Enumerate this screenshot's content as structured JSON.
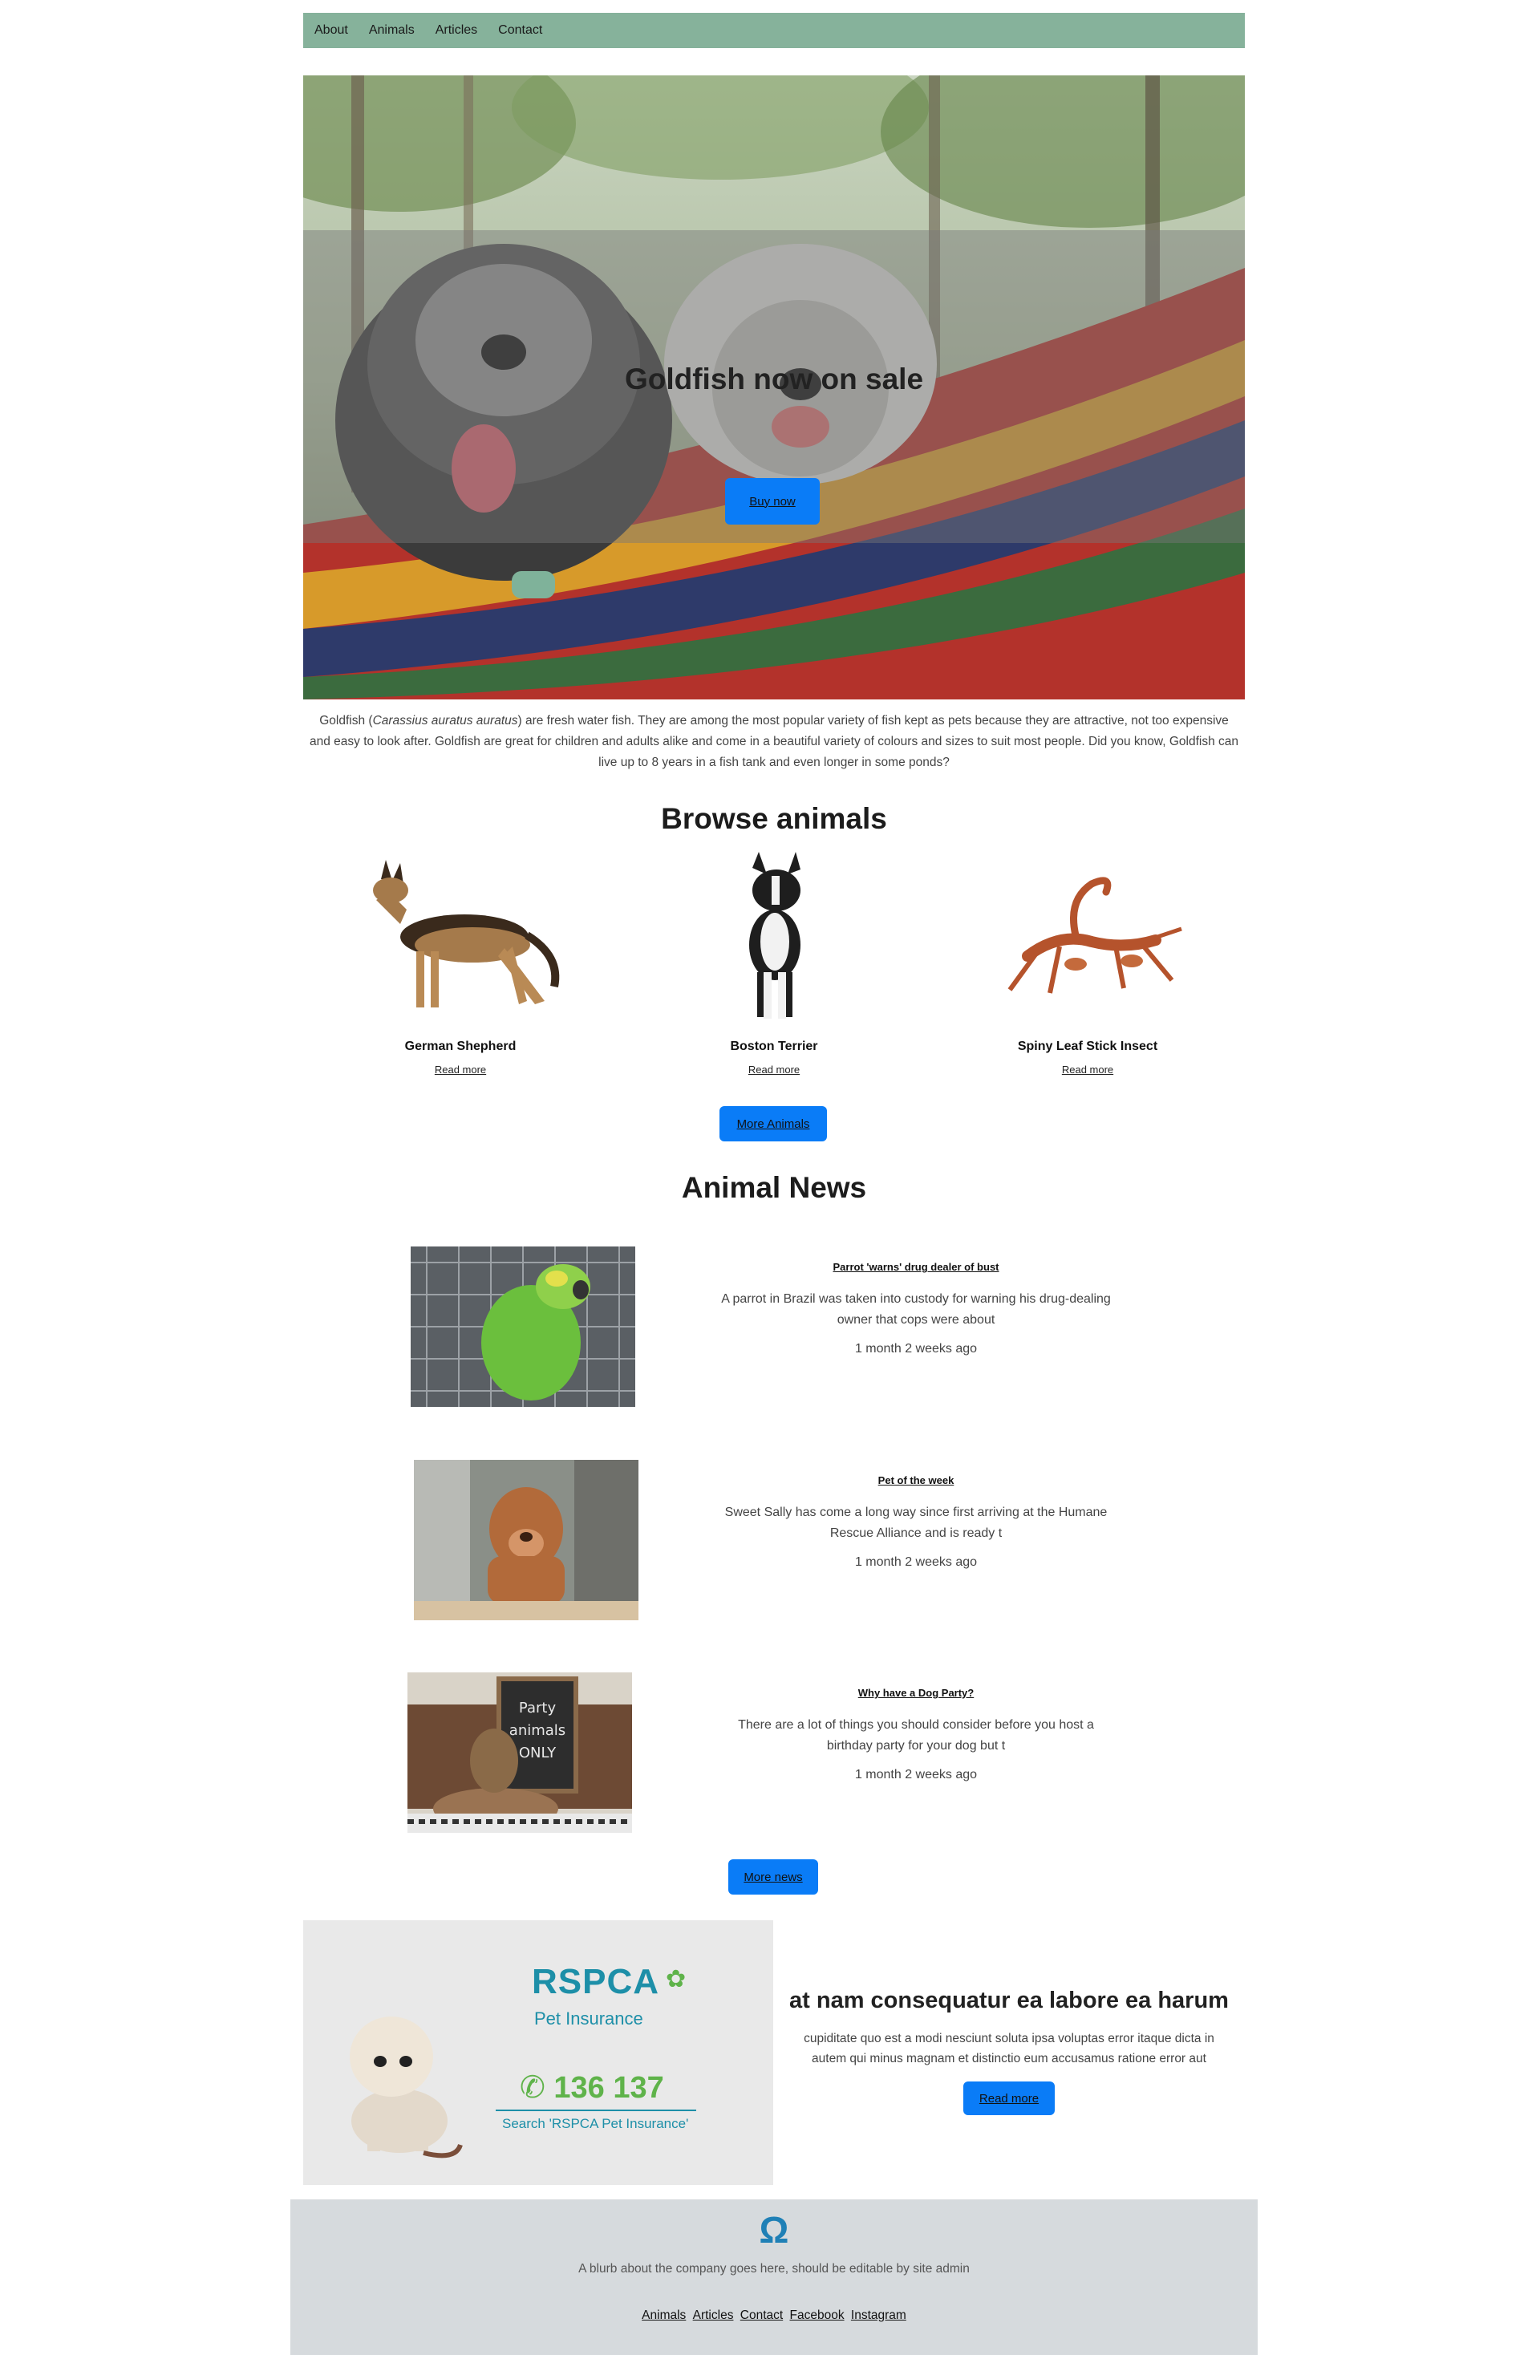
{
  "nav": {
    "items": [
      "About",
      "Animals",
      "Articles",
      "Contact"
    ]
  },
  "hero": {
    "title": "Goldfish now on sale",
    "button_label": "Buy now"
  },
  "intro": {
    "text_before": "Goldfish (",
    "text_italic": "Carassius auratus auratus",
    "text_after": ") are fresh water fish. They are among the most popular variety of fish kept as pets because they are attractive, not too expensive and easy to look after. Goldfish are great for children and adults alike and come in a beautiful variety of colours and sizes to suit most people. Did you know, Goldfish can live up to 8 years in a fish tank and even longer in some ponds?"
  },
  "browse": {
    "title": "Browse animals",
    "cards": [
      {
        "name": "German Shepherd",
        "link": "Read more"
      },
      {
        "name": "Boston Terrier",
        "link": "Read more"
      },
      {
        "name": "Spiny Leaf Stick Insect",
        "link": "Read more"
      }
    ],
    "more_button": "More Animals"
  },
  "news": {
    "title": "Animal News",
    "items": [
      {
        "title": "Parrot 'warns' drug dealer of bust",
        "excerpt": "A parrot in Brazil was taken into custody for warning his drug-dealing owner that cops were about",
        "time": "1 month 2 weeks ago"
      },
      {
        "title": "Pet of the week",
        "excerpt": "Sweet Sally has come a long way since first arriving at the Humane Rescue Alliance and is ready t",
        "time": "1 month 2 weeks ago"
      },
      {
        "title": "Why have a Dog Party?",
        "excerpt": "There are a lot of things you should consider before you host a birthday party for your dog but t",
        "time": "1 month 2 weeks ago"
      }
    ],
    "more_button": "More news"
  },
  "promo": {
    "ad": {
      "brand": "RSPCA",
      "product": "Pet Insurance",
      "phone": "136 137",
      "search": "Search 'RSPCA Pet Insurance'"
    },
    "title": "at nam consequatur ea labore ea harum",
    "body": "cupiditate quo est a modi nesciunt soluta ipsa voluptas error itaque dicta in autem qui minus magnam et distinctio eum accusamus ratione error aut",
    "button": "Read more"
  },
  "footer": {
    "logo": "Ω",
    "blurb": "A blurb about the company goes here, should be editable by site admin",
    "links": [
      "Animals",
      "Articles",
      "Contact",
      "Facebook",
      "Instagram"
    ]
  },
  "colors": {
    "nav_bg": "#86b29b",
    "button": "#0a7cf7",
    "footer_bg": "#d6dadd",
    "logo": "#1f80b6",
    "rspca_teal": "#1d8fa8",
    "rspca_green": "#5fb34a"
  }
}
